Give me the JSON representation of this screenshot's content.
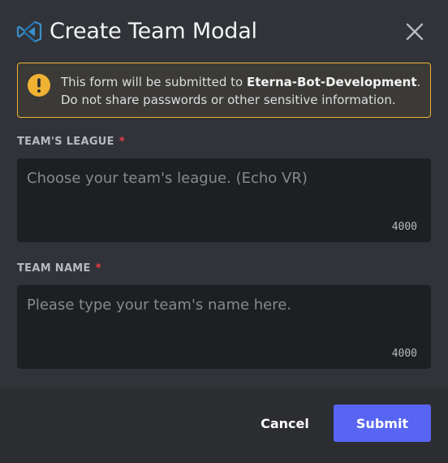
{
  "modal": {
    "title": "Create Team Modal",
    "icon": "vscode-logo-icon",
    "close_icon": "close-icon"
  },
  "notice": {
    "icon": "warning-icon",
    "prefix": "This form will be submitted to ",
    "app_name": "Eterna-Bot-Development",
    "suffix": ".",
    "line2": "Do not share passwords or other sensitive information.",
    "border_color": "#f0b232"
  },
  "fields": [
    {
      "label": "TEAM'S LEAGUE",
      "required_mark": "*",
      "placeholder": "Choose your team's league. (Echo VR)",
      "value": "",
      "max_length": "4000"
    },
    {
      "label": "TEAM NAME",
      "required_mark": "*",
      "placeholder": "Please type your team's name here.",
      "value": "",
      "max_length": "4000"
    }
  ],
  "footer": {
    "cancel_label": "Cancel",
    "submit_label": "Submit",
    "submit_color": "#5865f2"
  }
}
